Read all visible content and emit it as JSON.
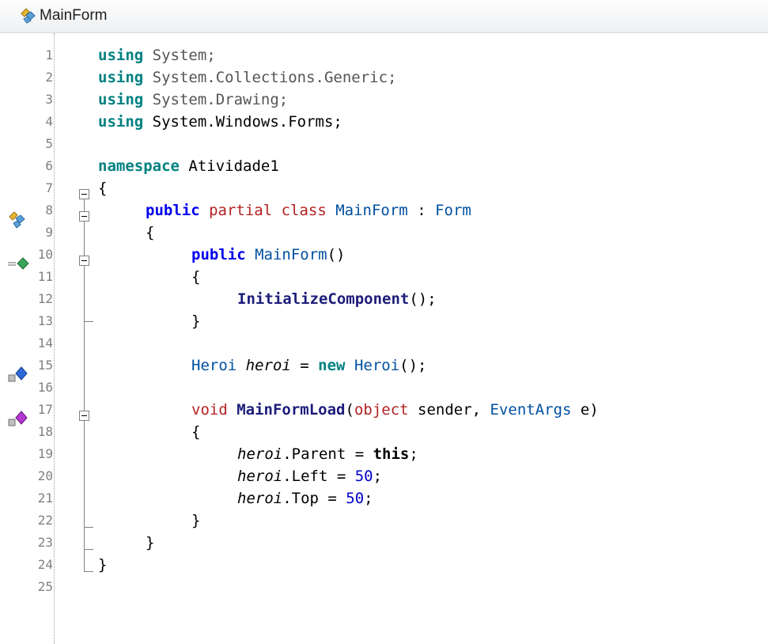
{
  "tab": {
    "title": "MainForm",
    "icon": "class-icon"
  },
  "line_numbers": [
    "1",
    "2",
    "3",
    "4",
    "5",
    "6",
    "7",
    "8",
    "9",
    "10",
    "11",
    "12",
    "13",
    "14",
    "15",
    "16",
    "17",
    "18",
    "19",
    "20",
    "21",
    "22",
    "23",
    "24",
    "25"
  ],
  "margin_icons": [
    {
      "line": 8,
      "icon": "class-icon"
    },
    {
      "line": 10,
      "icon": "constructor-icon"
    },
    {
      "line": 15,
      "icon": "field-icon"
    },
    {
      "line": 17,
      "icon": "method-icon"
    }
  ],
  "code": {
    "l1": {
      "kw": "using",
      "rest": " System;"
    },
    "l2": {
      "kw": "using",
      "rest": " System.Collections.Generic;"
    },
    "l3": {
      "kw": "using",
      "rest": " System.Drawing;"
    },
    "l4": {
      "kw": "using",
      "rest": " System.Windows.Forms;"
    },
    "l6": {
      "kw": "namespace",
      "rest": " Atividade1"
    },
    "l7": "{",
    "l8": {
      "public": "public",
      "partial": " partial",
      "class": " class",
      "name": " MainForm",
      "colon": " : ",
      "base": "Form"
    },
    "l9": "{",
    "l10": {
      "public": "public",
      "name": " MainForm",
      "parens": "()"
    },
    "l11": "{",
    "l12": {
      "call": "InitializeComponent",
      "end": "();"
    },
    "l13": "}",
    "l15": {
      "type": "Heroi",
      "var": " heroi",
      "eq": " = ",
      "new": "new",
      "type2": " Heroi",
      "end": "();"
    },
    "l17": {
      "void": "void",
      "name": " MainFormLoad",
      "open": "(",
      "obj": "object",
      "p1": " sender, ",
      "args": "EventArgs",
      "p2": " e)"
    },
    "l18": "{",
    "l19": {
      "var": "heroi",
      "prop": ".Parent = ",
      "this": "this",
      "end": ";"
    },
    "l20": {
      "var": "heroi",
      "prop": ".Left = ",
      "num": "50",
      "end": ";"
    },
    "l21": {
      "var": "heroi",
      "prop": ".Top = ",
      "num": "50",
      "end": ";"
    },
    "l22": "}",
    "l23": "}",
    "l24": "}"
  }
}
